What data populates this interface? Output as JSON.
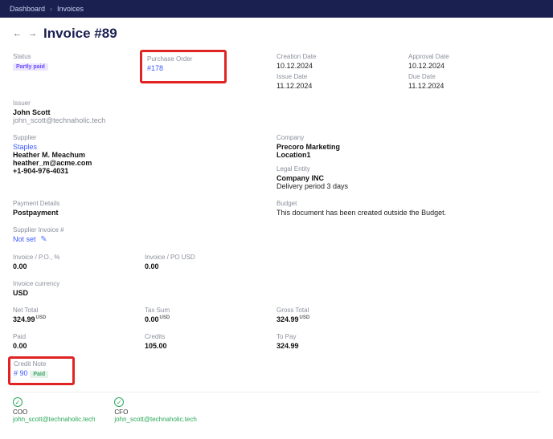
{
  "breadcrumb": {
    "root": "Dashboard",
    "current": "Invoices"
  },
  "title": "Invoice #89",
  "statusBlock": {
    "label": "Status",
    "badge": "Partly paid"
  },
  "po": {
    "label": "Purchase Order",
    "link": "#178"
  },
  "dates": {
    "creationLabel": "Creation Date",
    "creation": "10.12.2024",
    "approvalLabel": "Approval Date",
    "approval": "10.12.2024",
    "issueLabel": "Issue Date",
    "issue": "11.12.2024",
    "dueLabel": "Due Date",
    "due": "11.12.2024"
  },
  "issuer": {
    "label": "Issuer",
    "name": "John Scott",
    "email": "john_scott@technaholic.tech"
  },
  "supplier": {
    "label": "Supplier",
    "company": "Staples",
    "contact": "Heather M. Meachum",
    "email": "heather_m@acme.com",
    "phone": "+1-904-976-4031"
  },
  "company": {
    "label": "Company",
    "name": "Precoro Marketing",
    "location": "Location1"
  },
  "legal": {
    "label": "Legal Entity",
    "name": "Company INC",
    "delivery": "Delivery period 3 days"
  },
  "budget": {
    "label": "Budget",
    "note": "This document has been created outside the Budget."
  },
  "payment": {
    "label": "Payment Details",
    "value": "Postpayment"
  },
  "supplierInvoice": {
    "label": "Supplier Invoice #",
    "value": "Not set"
  },
  "ratios": {
    "pctLabel": "Invoice / P.O., %",
    "pct": "0.00",
    "usdLabel": "Invoice / PO USD",
    "usd": "0.00"
  },
  "currency": {
    "label": "Invoice currency",
    "value": "USD"
  },
  "totals": {
    "netLabel": "Net Total",
    "net": "324.99",
    "taxLabel": "Tax Sum",
    "tax": "0.00",
    "grossLabel": "Gross Total",
    "gross": "324.99",
    "usd": "USD",
    "paidLabel": "Paid",
    "paid": "0.00",
    "creditsLabel": "Credits",
    "credits": "105.00",
    "topayLabel": "To Pay",
    "topay": "324.99"
  },
  "creditNote": {
    "label": "Credit Note",
    "link": "# 90",
    "badge": "Paid"
  },
  "approvers": [
    {
      "role": "COO",
      "email": "john_scott@technaholic.tech"
    },
    {
      "role": "CFO",
      "email": "john_scott@technaholic.tech"
    }
  ]
}
